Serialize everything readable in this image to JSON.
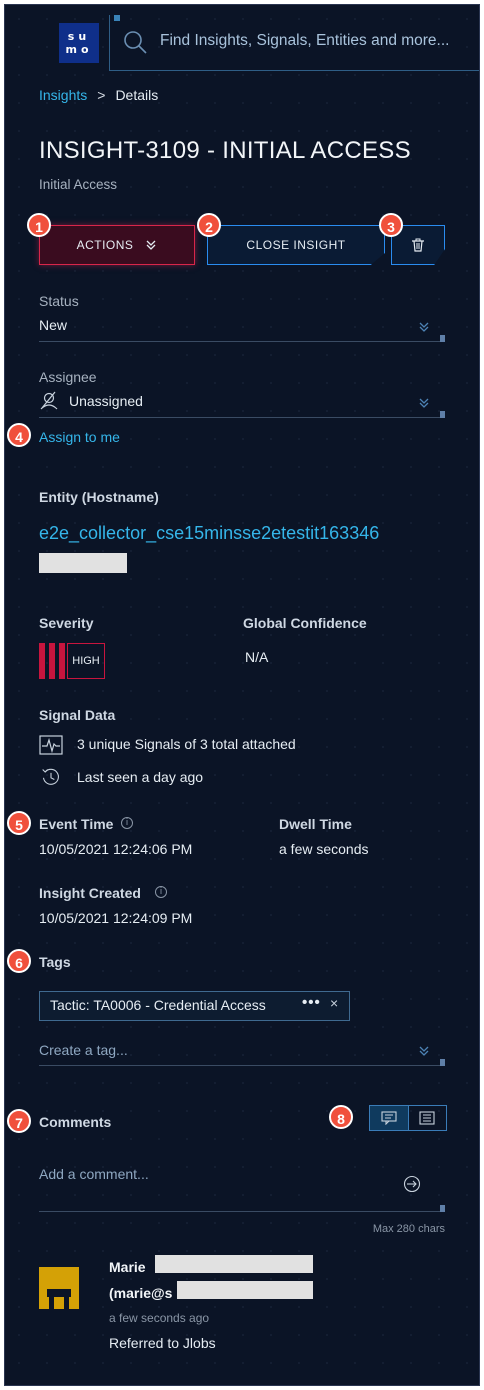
{
  "header": {
    "logo_text_top": "su",
    "logo_text_bottom": "mo",
    "search_placeholder": "Find Insights, Signals, Entities and more..."
  },
  "breadcrumb": {
    "parent": "Insights",
    "separator": ">",
    "current": "Details"
  },
  "insight": {
    "title": "INSIGHT-3109 - INITIAL ACCESS",
    "subtitle": "Initial Access"
  },
  "buttons": {
    "actions_label": "ACTIONS",
    "close_label": "CLOSE INSIGHT"
  },
  "badges": [
    "1",
    "2",
    "3",
    "4",
    "5",
    "6",
    "7",
    "8"
  ],
  "status": {
    "label": "Status",
    "value": "New"
  },
  "assignee": {
    "label": "Assignee",
    "value": "Unassigned",
    "assign_link": "Assign to me"
  },
  "entity": {
    "label": "Entity (Hostname)",
    "value": "e2e_collector_cse15minsse2etestit163346"
  },
  "severity": {
    "label": "Severity",
    "value": "HIGH",
    "color": "#c8153e"
  },
  "confidence": {
    "label": "Global Confidence",
    "value": "N/A"
  },
  "signal_data": {
    "label": "Signal Data",
    "signals_text": "3 unique Signals of 3 total attached",
    "last_seen_text": "Last seen a day ago"
  },
  "times": {
    "event_label": "Event Time",
    "event_value": "10/05/2021 12:24:06 PM",
    "dwell_label": "Dwell Time",
    "dwell_value": "a few seconds",
    "created_label": "Insight Created",
    "created_value": "10/05/2021 12:24:09 PM",
    "info_glyph": "i"
  },
  "tags": {
    "label": "Tags",
    "items": [
      {
        "text": "Tactic: TA0006 - Credential Access"
      }
    ],
    "more_glyph": "•••",
    "remove_glyph": "×",
    "create_placeholder": "Create a tag..."
  },
  "comments": {
    "label": "Comments",
    "input_placeholder": "Add a comment...",
    "max_chars": "Max 280 chars",
    "items": [
      {
        "name": "Marie",
        "email_prefix": "(marie@s",
        "time": "a few seconds ago",
        "text": "Referred to Jlobs"
      }
    ]
  },
  "colors": {
    "background": "#0b1426",
    "accent_link": "#35b6ea",
    "danger": "#d8264a",
    "primary_border": "#2a8cf0",
    "badge": "#f0503c",
    "avatar": "#d4a106"
  }
}
